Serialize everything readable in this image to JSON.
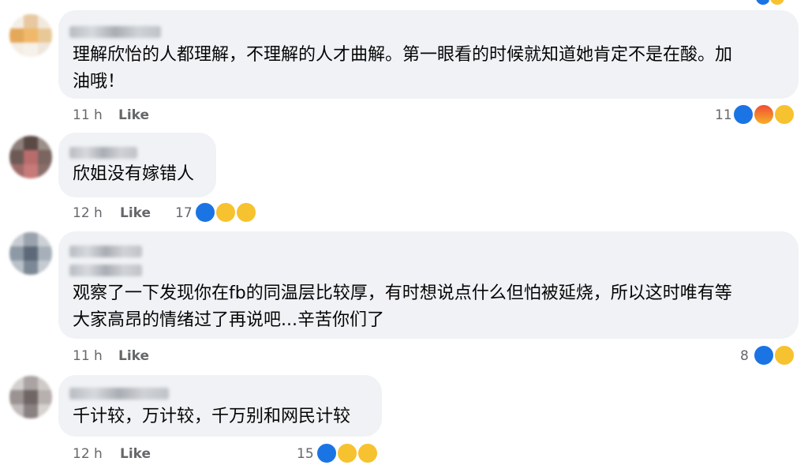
{
  "comments": [
    {
      "text_lines": [
        "理解欣怡的人都理解，不理解的人才曲解。第一眼看的时候就知道她肯定不是在酸。加",
        "油哦！"
      ],
      "time": "11 h",
      "like_label": "Like",
      "reaction_count": "11",
      "reactions": [
        "like-icon",
        "angry-icon",
        "care-icon"
      ]
    },
    {
      "text_lines": [
        "欣姐没有嫁错人"
      ],
      "time": "12 h",
      "like_label": "Like",
      "reaction_count": "17",
      "reactions": [
        "like-icon",
        "haha-icon",
        "care-icon"
      ]
    },
    {
      "text_lines": [
        "观察了一下发现你在fb的同温层比较厚，有时想说点什么但怕被延烧，所以这时唯有等",
        "大家高昂的情绪过了再说吧...辛苦你们了"
      ],
      "time": "11 h",
      "like_label": "Like",
      "reaction_count": "8",
      "reactions": [
        "like-icon",
        "care-icon"
      ]
    },
    {
      "text_lines": [
        "千计较，万计较，千万别和网民计较"
      ],
      "time": "12 h",
      "like_label": "Like",
      "reaction_count": "15",
      "reactions": [
        "like-icon",
        "haha-icon",
        "care-icon"
      ]
    }
  ],
  "colors": {
    "bubble": "#f0f2f5",
    "meta_text": "#65676b",
    "like_blue": "#1b74e4"
  }
}
